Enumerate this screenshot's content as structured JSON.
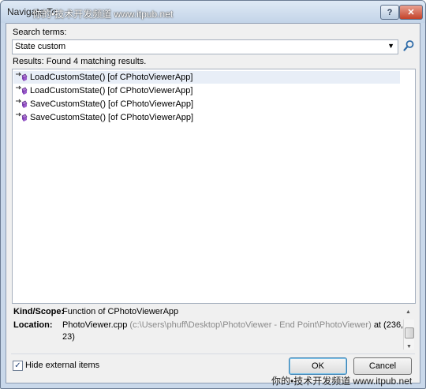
{
  "window": {
    "title": "Navigate To",
    "watermark_top": "你的•技术开发频道 www.itpub.net",
    "help_glyph": "?",
    "close_glyph": "✕"
  },
  "search": {
    "label": "Search terms:",
    "value": "State custom"
  },
  "results": {
    "label": "Results: Found 4 matching results.",
    "items": [
      {
        "text": "LoadCustomState() [of CPhotoViewerApp]",
        "icon": "method-icon"
      },
      {
        "text": "LoadCustomState() [of CPhotoViewerApp]",
        "icon": "method-icon"
      },
      {
        "text": "SaveCustomState() [of CPhotoViewerApp]",
        "icon": "method-icon"
      },
      {
        "text": "SaveCustomState() [of CPhotoViewerApp]",
        "icon": "method-icon"
      }
    ]
  },
  "details": {
    "kind_label": "Kind/Scope:",
    "kind_value": "Function of CPhotoViewerApp",
    "location_label": "Location:",
    "location_file": "PhotoViewer.cpp",
    "location_path": "(c:\\Users\\phuff\\Desktop\\PhotoViewer - End Point\\PhotoViewer)",
    "location_at": "at (236,",
    "location_line2": "23)"
  },
  "options": {
    "hide_external_label": "Hide external items",
    "hide_external_checked": true
  },
  "buttons": {
    "ok": "OK",
    "cancel": "Cancel"
  },
  "watermark_bottom": "你的•技术开发频道 www.itpub.net"
}
